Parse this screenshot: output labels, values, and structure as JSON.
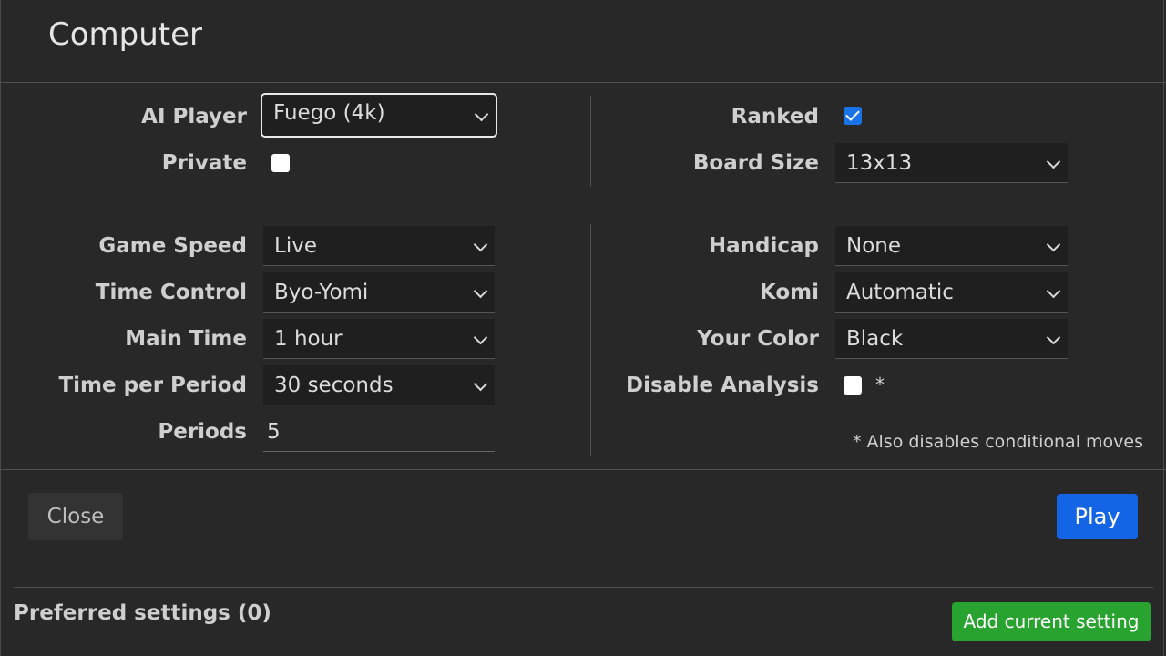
{
  "dialog": {
    "title": "Computer"
  },
  "top_left": {
    "ai_player_label": "AI Player",
    "ai_player_value": "Fuego (4k)",
    "private_label": "Private",
    "private_checked": false
  },
  "top_right": {
    "ranked_label": "Ranked",
    "ranked_checked": true,
    "board_size_label": "Board Size",
    "board_size_value": "13x13"
  },
  "time_settings": {
    "game_speed_label": "Game Speed",
    "game_speed_value": "Live",
    "time_control_label": "Time Control",
    "time_control_value": "Byo-Yomi",
    "main_time_label": "Main Time",
    "main_time_value": "1 hour",
    "time_per_period_label": "Time per Period",
    "time_per_period_value": "30 seconds",
    "periods_label": "Periods",
    "periods_value": "5"
  },
  "game_settings": {
    "handicap_label": "Handicap",
    "handicap_value": "None",
    "komi_label": "Komi",
    "komi_value": "Automatic",
    "your_color_label": "Your Color",
    "your_color_value": "Black",
    "disable_analysis_label": "Disable Analysis",
    "disable_analysis_checked": false,
    "asterisk": "*",
    "footnote": "* Also disables conditional moves"
  },
  "buttons": {
    "close_label": "Close",
    "play_label": "Play",
    "add_current_setting_label": "Add current setting"
  },
  "preferred": {
    "label": "Preferred settings (0)"
  },
  "colors": {
    "background": "#282828",
    "play_button": "#1464e6",
    "add_button": "#29a330",
    "checkbox_checked": "#1a73e8"
  }
}
